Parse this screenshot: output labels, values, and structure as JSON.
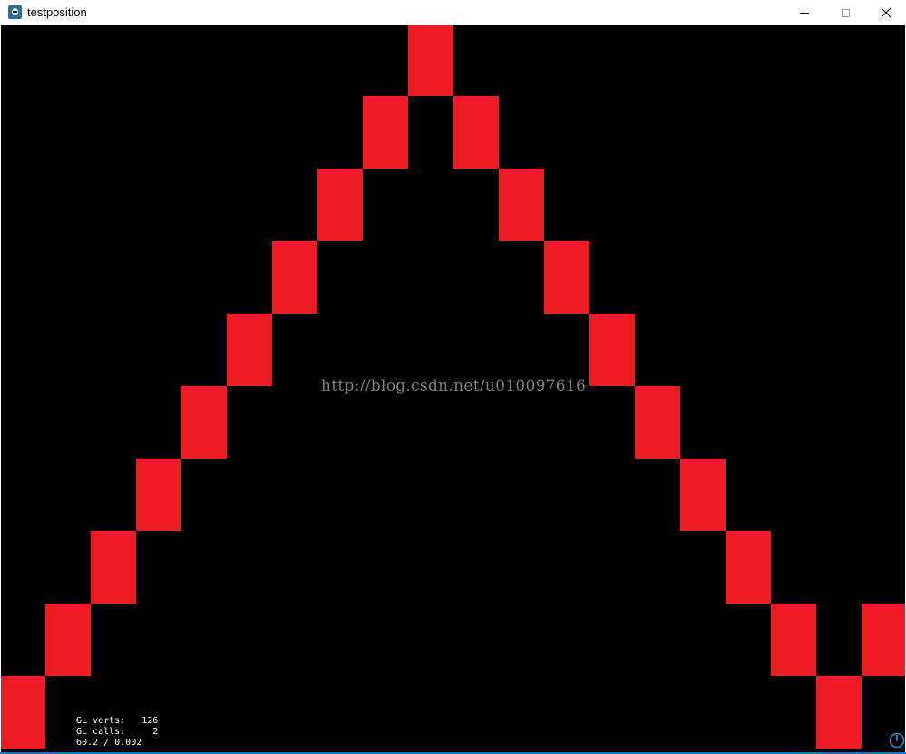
{
  "window": {
    "title": "testposition",
    "app_icon": "cocos-app-icon",
    "controls": {
      "minimize_icon": "minimize-icon",
      "maximize_icon": "maximize-icon",
      "close_icon": "close-icon"
    }
  },
  "scene": {
    "background_color": "#000000",
    "tile_color": "#ed1c24",
    "tiles": [
      {
        "col": 0,
        "row": 9
      },
      {
        "col": 1,
        "row": 8
      },
      {
        "col": 2,
        "row": 7
      },
      {
        "col": 3,
        "row": 6
      },
      {
        "col": 4,
        "row": 5
      },
      {
        "col": 5,
        "row": 4
      },
      {
        "col": 6,
        "row": 3
      },
      {
        "col": 7,
        "row": 2
      },
      {
        "col": 8,
        "row": 1
      },
      {
        "col": 9,
        "row": 0
      },
      {
        "col": 10,
        "row": 1
      },
      {
        "col": 11,
        "row": 2
      },
      {
        "col": 12,
        "row": 3
      },
      {
        "col": 13,
        "row": 4
      },
      {
        "col": 14,
        "row": 5
      },
      {
        "col": 15,
        "row": 6
      },
      {
        "col": 16,
        "row": 7
      },
      {
        "col": 17,
        "row": 8
      },
      {
        "col": 18,
        "row": 9
      },
      {
        "col": 19,
        "row": 8
      }
    ],
    "watermark": "http://blog.csdn.net/u010097616"
  },
  "stats": {
    "line1": "GL verts:   126",
    "line2": "GL calls:     2",
    "line3": "60.2 / 0.002"
  },
  "corner_icon": "power-icon"
}
